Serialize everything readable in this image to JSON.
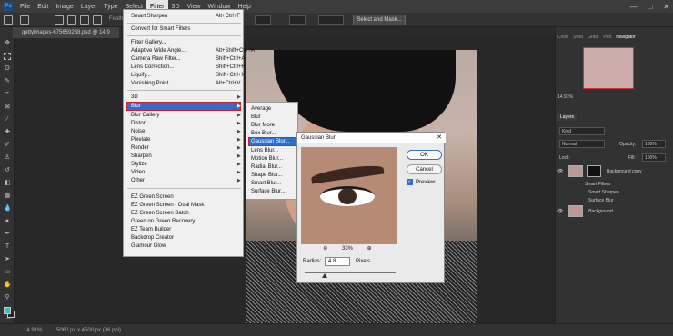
{
  "app": {
    "logo": "Ps"
  },
  "menubar": {
    "items": [
      "File",
      "Edit",
      "Image",
      "Layer",
      "Type",
      "Select",
      "Filter",
      "3D",
      "View",
      "Window",
      "Help"
    ],
    "active": "Filter",
    "window_controls": [
      "—",
      "□",
      "✕"
    ]
  },
  "options": {
    "select_mask": "Select and Mask...",
    "feather_label": "Feathe"
  },
  "document": {
    "tab": "gettyimages-675659238.psd @ 14.9"
  },
  "filter_menu": {
    "top": [
      {
        "label": "Smart Sharpen",
        "shortcut": "Alt+Ctrl+F"
      }
    ],
    "convert": "Convert for Smart Filters",
    "middle": [
      {
        "label": "Filter Gallery...",
        "shortcut": ""
      },
      {
        "label": "Adaptive Wide Angle...",
        "shortcut": "Alt+Shift+Ctrl+A"
      },
      {
        "label": "Camera Raw Filter...",
        "shortcut": "Shift+Ctrl+A"
      },
      {
        "label": "Lens Correction...",
        "shortcut": "Shift+Ctrl+R"
      },
      {
        "label": "Liquify...",
        "shortcut": "Shift+Ctrl+X"
      },
      {
        "label": "Vanishing Point...",
        "shortcut": "Alt+Ctrl+V"
      }
    ],
    "groups": [
      "3D",
      "Blur",
      "Blur Gallery",
      "Distort",
      "Noise",
      "Pixelate",
      "Render",
      "Sharpen",
      "Stylize",
      "Video",
      "Other"
    ],
    "plugins": [
      "EZ Green Screen",
      "EZ Green Screen - Dual Mask",
      "EZ Green Screen Batch",
      "Green on Green Recovery",
      "EZ Team Builder",
      "Backdrop Creator",
      "Glamour Glow"
    ]
  },
  "blur_menu": {
    "items": [
      "Average",
      "Blur",
      "Blur More",
      "Box Blur...",
      "Gaussian Blur...",
      "Lens Blur...",
      "Motion Blur...",
      "Radial Blur...",
      "Shape Blur...",
      "Smart Blur...",
      "Surface Blur..."
    ]
  },
  "dialog": {
    "title": "Gaussian Blur",
    "close": "✕",
    "ok": "OK",
    "cancel": "Cancel",
    "preview_label": "Preview",
    "zoom": "33%",
    "zoom_out": "⊖",
    "zoom_in": "⊕",
    "radius_label": "Radius:",
    "radius_value": "4.8",
    "units": "Pixels"
  },
  "panels": {
    "tabs": [
      "Color",
      "Swat",
      "Gradi",
      "Patt",
      "Navigator"
    ],
    "active_tab": "Navigator",
    "zoom": "14.91%",
    "layers_title": "Layers",
    "kind": "Kind",
    "blend": "Normal",
    "opacity_label": "Opacity:",
    "opacity": "100%",
    "lock_label": "Lock:",
    "fill_label": "Fill:",
    "fill": "100%",
    "layers": [
      {
        "name": "Background copy"
      },
      {
        "name": "Smart Filters"
      },
      {
        "name": "Smart Sharpen"
      },
      {
        "name": "Surface Blur"
      },
      {
        "name": "Background"
      }
    ]
  },
  "status": {
    "zoom": "14.91%",
    "doc_info": "5060 px x 4500 px (96 ppi)"
  }
}
